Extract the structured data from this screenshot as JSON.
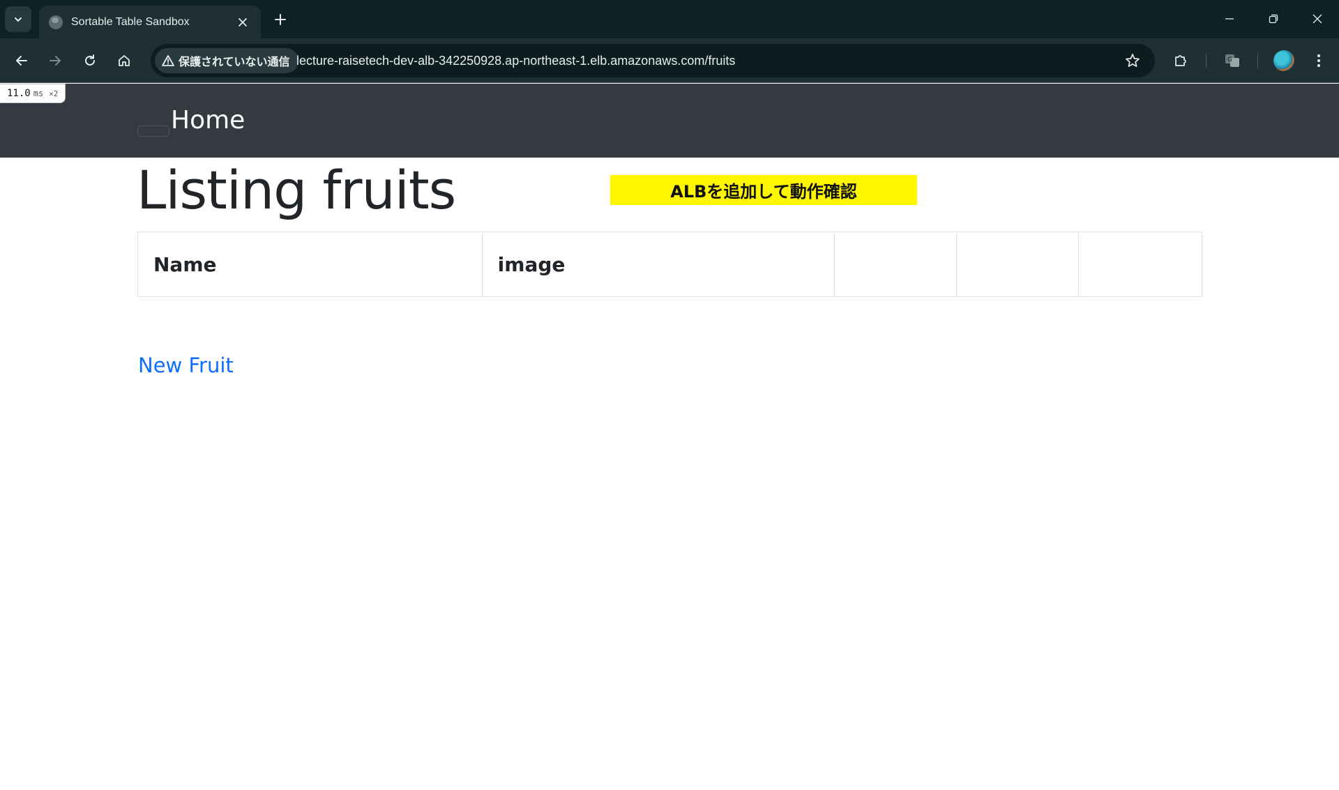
{
  "browser": {
    "tab": {
      "title": "Sortable Table Sandbox"
    },
    "omnibox": {
      "security_label": "保護されていない通信",
      "url": "lecture-raisetech-dev-alb-342250928.ap-northeast-1.elb.amazonaws.com/fruits"
    },
    "perf_badge": {
      "value": "11.0",
      "unit": "ms",
      "multiplier": "×2"
    }
  },
  "nav": {
    "brand": "Home"
  },
  "page": {
    "title": "Listing fruits",
    "banner": "ALBを追加して動作確認",
    "banner_color": "#fff700",
    "table": {
      "headers": [
        "Name",
        "image",
        "",
        "",
        ""
      ]
    },
    "new_link": "New Fruit",
    "link_color": "#0d6efd"
  }
}
